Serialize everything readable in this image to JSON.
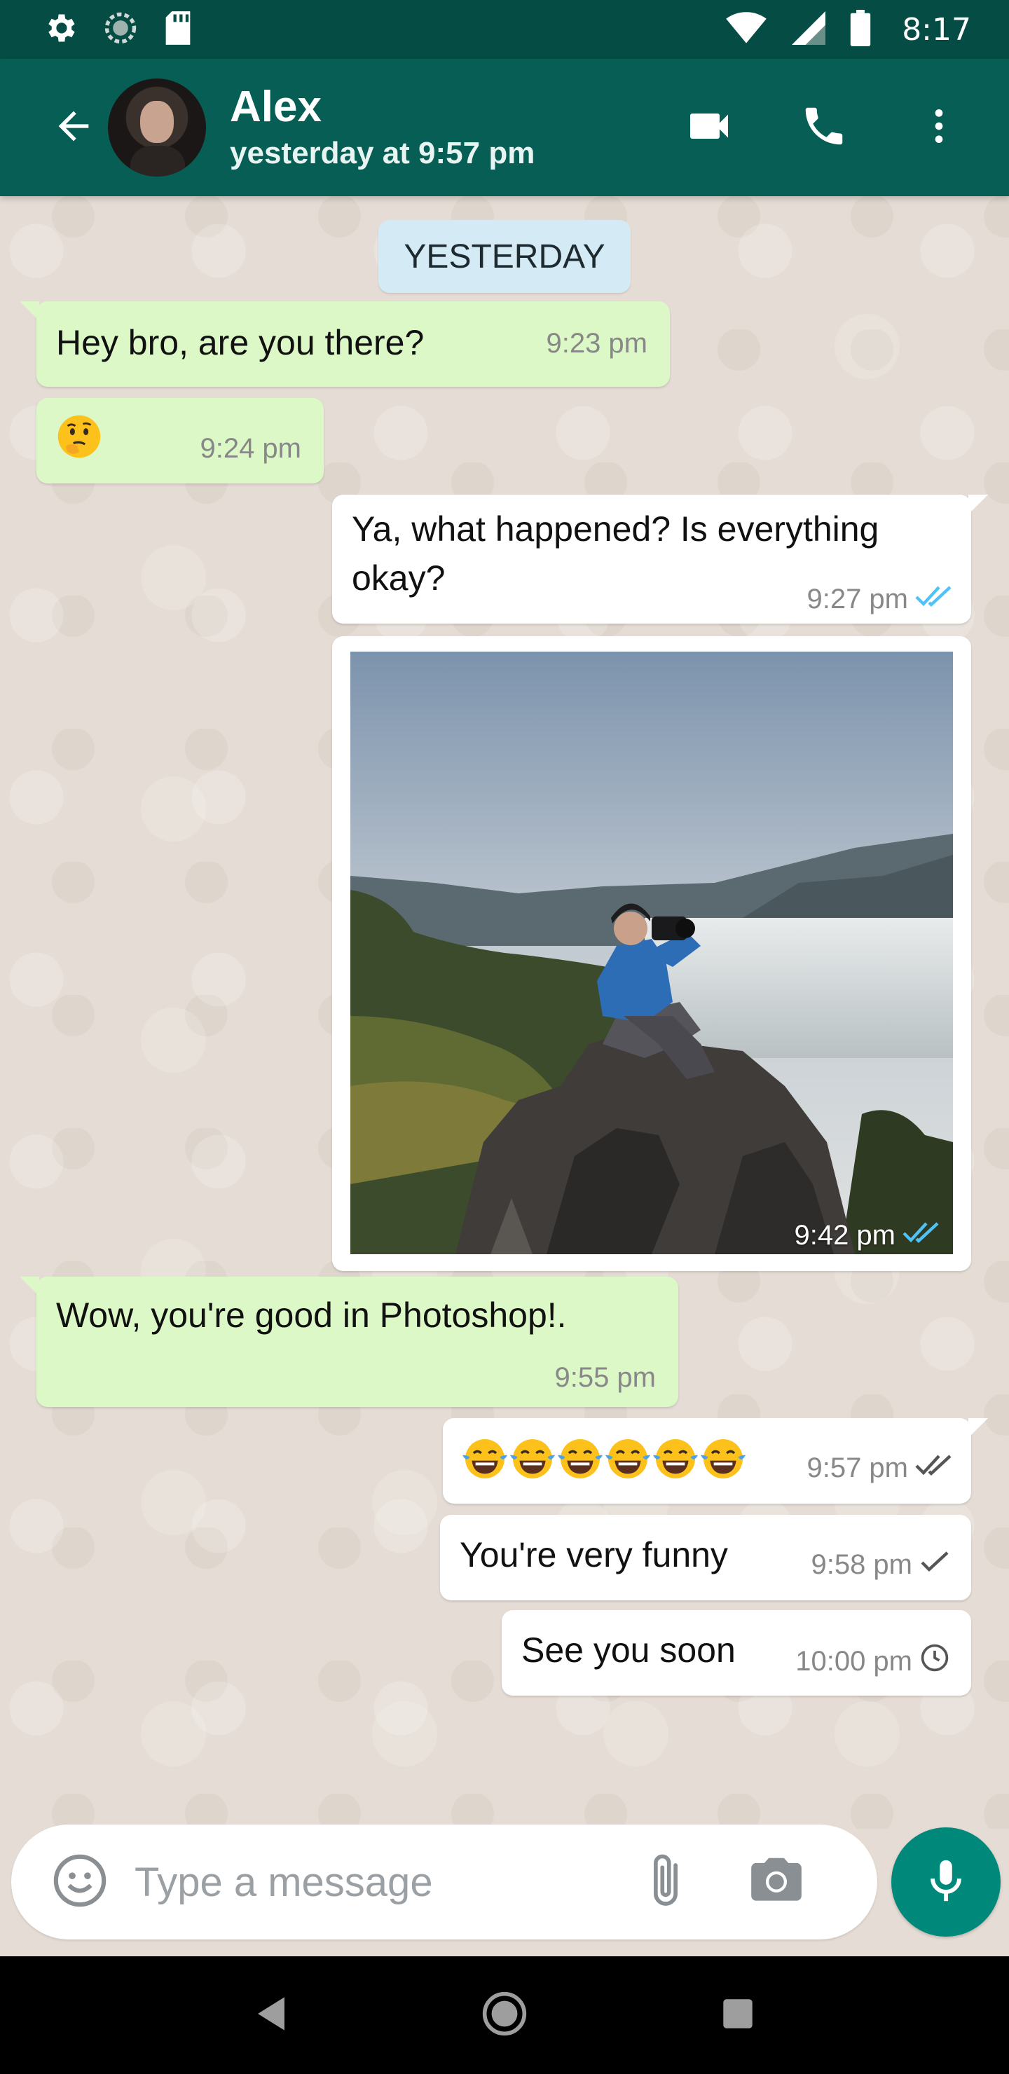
{
  "status_bar": {
    "time": "8:17",
    "icons": [
      "gear-icon",
      "sync-icon",
      "sd-card-icon",
      "wifi-icon",
      "signal-icon",
      "battery-icon"
    ]
  },
  "header": {
    "contact_name": "Alex",
    "contact_status": "yesterday at 9:57 pm",
    "icons": [
      "back-arrow-icon",
      "video-call-icon",
      "phone-icon",
      "more-vert-icon"
    ]
  },
  "chat": {
    "date_label": "YESTERDAY",
    "messages": [
      {
        "direction": "in",
        "text": "Hey bro, are you there?",
        "time": "9:23 pm"
      },
      {
        "direction": "in",
        "text": "",
        "emoji": [
          "thinking-face"
        ],
        "time": "9:24 pm"
      },
      {
        "direction": "out",
        "text": "Ya, what happened? Is everything okay?",
        "time": "9:27 pm",
        "status": "read"
      },
      {
        "direction": "out",
        "type": "image",
        "image": "photographer-on-mountain-photo",
        "time": "9:42 pm",
        "status": "read"
      },
      {
        "direction": "in",
        "text": "Wow, you're good in Photoshop!.",
        "time": "9:55 pm"
      },
      {
        "direction": "out",
        "text": "",
        "emoji": [
          "tears-of-joy",
          "tears-of-joy",
          "tears-of-joy",
          "tears-of-joy",
          "tears-of-joy",
          "tears-of-joy"
        ],
        "time": "9:57 pm",
        "status": "delivered"
      },
      {
        "direction": "out",
        "text": "You're very funny",
        "time": "9:58 pm",
        "status": "sent"
      },
      {
        "direction": "out",
        "text": "See you soon",
        "time": "10:00 pm",
        "status": "pending"
      }
    ]
  },
  "composer": {
    "placeholder": "Type a message",
    "value": ""
  },
  "colors": {
    "header": "#075e54",
    "status_bar": "#054d44",
    "incoming_bubble": "#dcf8c6",
    "outgoing_bubble": "#ffffff",
    "chat_background": "#e5ddd5",
    "read_ticks": "#4fc3f7",
    "mic_button": "#00897b",
    "date_pill": "#d4eaf4"
  }
}
